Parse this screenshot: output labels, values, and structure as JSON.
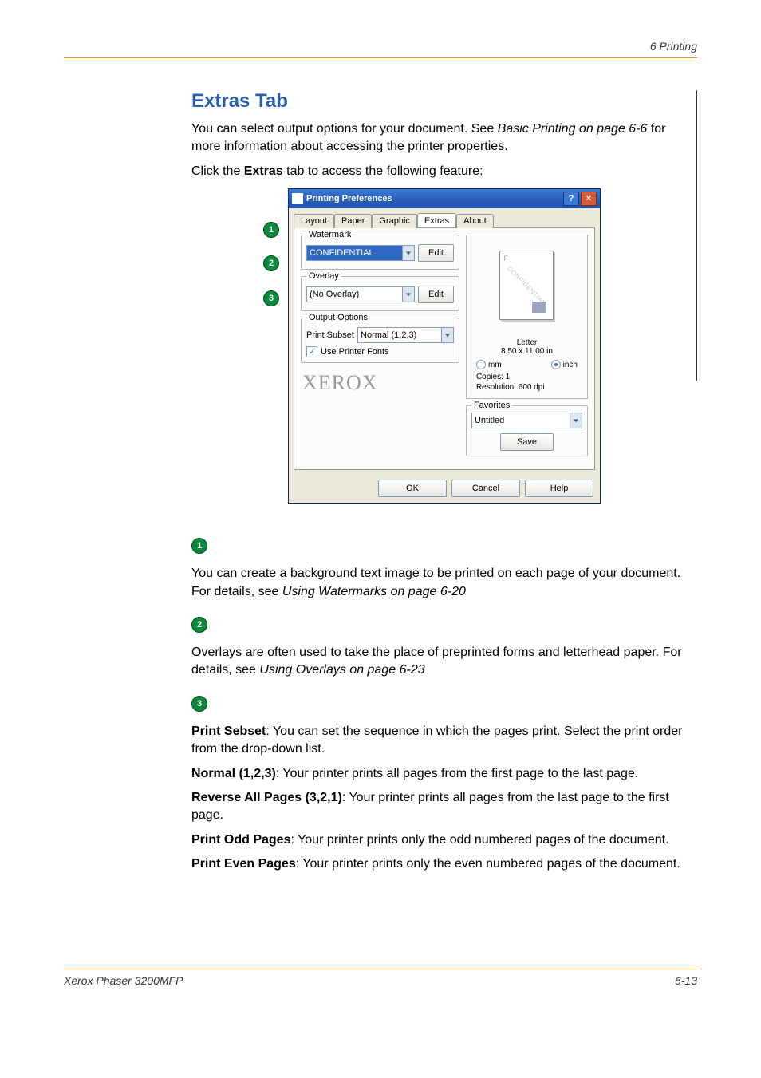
{
  "header": {
    "chapter": "6   Printing"
  },
  "section": {
    "title": "Extras Tab"
  },
  "intro": {
    "p1a": "You can select output options for your document. See ",
    "p1b": "Basic Printing on page 6-6",
    "p1c": " for more information about accessing the printer properties.",
    "p2a": "Click the ",
    "p2b": "Extras",
    "p2c": " tab to access the following feature:"
  },
  "dialog": {
    "title": "Printing Preferences",
    "help_btn": "?",
    "close_btn": "×",
    "tabs": [
      "Layout",
      "Paper",
      "Graphic",
      "Extras",
      "About"
    ],
    "watermark": {
      "legend": "Watermark",
      "value": "CONFIDENTIAL",
      "edit": "Edit"
    },
    "overlay": {
      "legend": "Overlay",
      "value": "(No Overlay)",
      "edit": "Edit"
    },
    "output": {
      "legend": "Output Options",
      "label": "Print Subset",
      "value": "Normal (1,2,3)",
      "use_fonts": "Use Printer Fonts",
      "check": "✓"
    },
    "preview": {
      "f": "F",
      "wm": "CONFIDENTIAL"
    },
    "info": {
      "size_name": "Letter",
      "size_dim": "8.50 x 11.00 in",
      "unit_mm": "mm",
      "unit_inch": "inch",
      "copies": "Copies: 1",
      "resolution": "Resolution: 600 dpi"
    },
    "favorites": {
      "legend": "Favorites",
      "value": "Untitled",
      "save": "Save"
    },
    "brand": "XEROX",
    "buttons": {
      "ok": "OK",
      "cancel": "Cancel",
      "help": "Help"
    }
  },
  "callouts": {
    "c1": "1",
    "c2": "2",
    "c3": "3"
  },
  "notes": {
    "n1a": "You can create a background text image to be printed on each page of your document. For details, see ",
    "n1b": "Using Watermarks on page 6-20",
    "n2a": "Overlays are often used to take the place of preprinted forms and letterhead paper. For details, see ",
    "n2b": "Using Overlays on page 6-23",
    "n3_1a": "Print Sebset",
    "n3_1b": ": You can set the sequence in which the pages print. Select the print order from the drop-down list.",
    "n3_2a": "Normal (1,2,3)",
    "n3_2b": ": Your printer prints all pages from the first page to the last page.",
    "n3_3a": "Reverse All Pages (3,2,1)",
    "n3_3b": ": Your printer prints all pages from the last page to the first page.",
    "n3_4a": "Print Odd Pages",
    "n3_4b": ": Your printer prints only the odd numbered pages of the document.",
    "n3_5a": "Print Even Pages",
    "n3_5b": ": Your printer prints only the even numbered pages of the document."
  },
  "footer": {
    "left": "Xerox Phaser 3200MFP",
    "right": "6-13"
  }
}
